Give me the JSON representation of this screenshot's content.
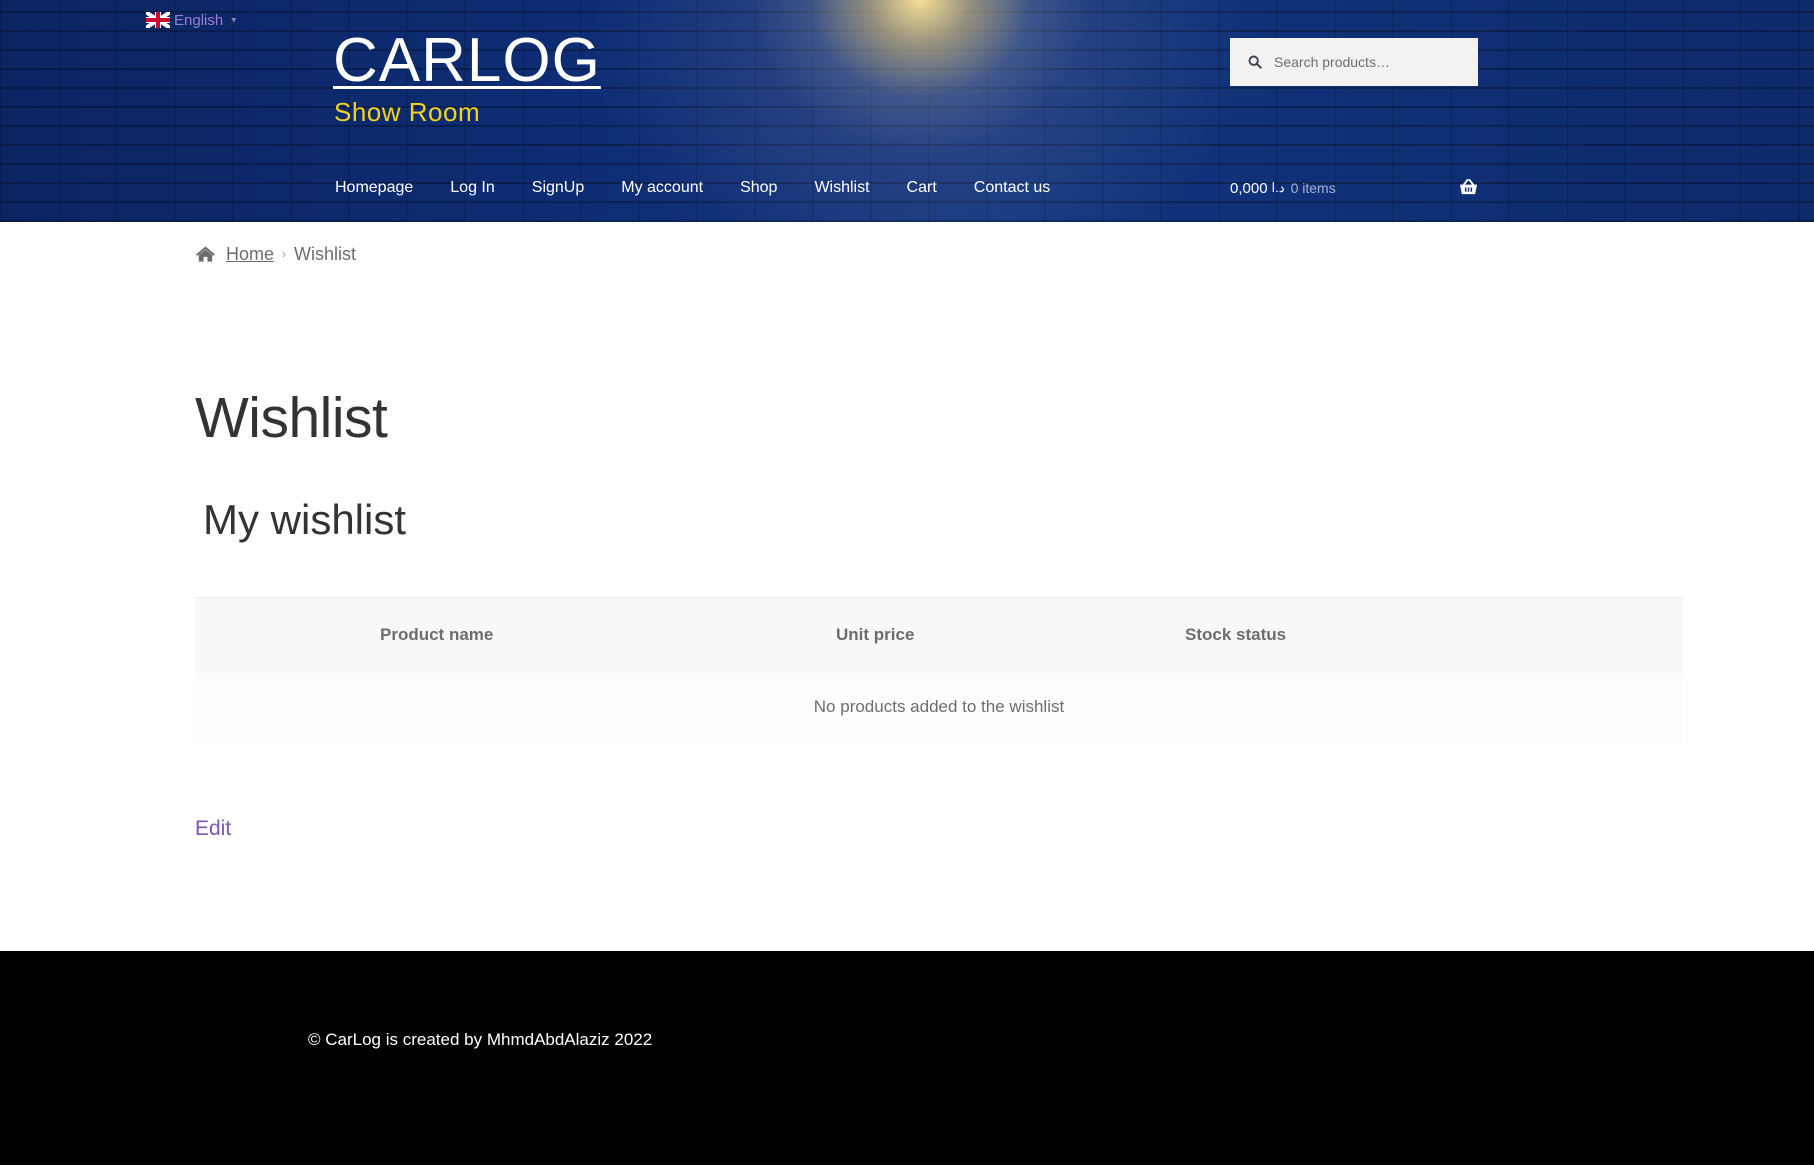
{
  "language": {
    "label": "English",
    "caret": "▾"
  },
  "site": {
    "title": "CARLOG",
    "tagline": "Show Room"
  },
  "search": {
    "placeholder": "Search products…"
  },
  "nav": {
    "items": [
      "Homepage",
      "Log In",
      "SignUp",
      "My account",
      "Shop",
      "Wishlist",
      "Cart",
      "Contact us"
    ]
  },
  "cart": {
    "amount": "0,000",
    "currency": "د.ا",
    "count_num": "0",
    "count_label": "items"
  },
  "breadcrumb": {
    "home": "Home",
    "separator": "›",
    "current": "Wishlist"
  },
  "page": {
    "title": "Wishlist",
    "wishlist_title": "My wishlist",
    "table": {
      "headers": [
        "Product name",
        "Unit price",
        "Stock status"
      ],
      "empty_message": "No products added to the wishlist"
    },
    "edit_label": "Edit"
  },
  "footer": {
    "copyright": "© CarLog is created by MhmdAbdAlaziz 2022"
  },
  "colors": {
    "header_bg": "#0f2f78",
    "tagline": "#f2d31b",
    "link_purple": "#7f54b3",
    "footer_bg": "#000000"
  }
}
